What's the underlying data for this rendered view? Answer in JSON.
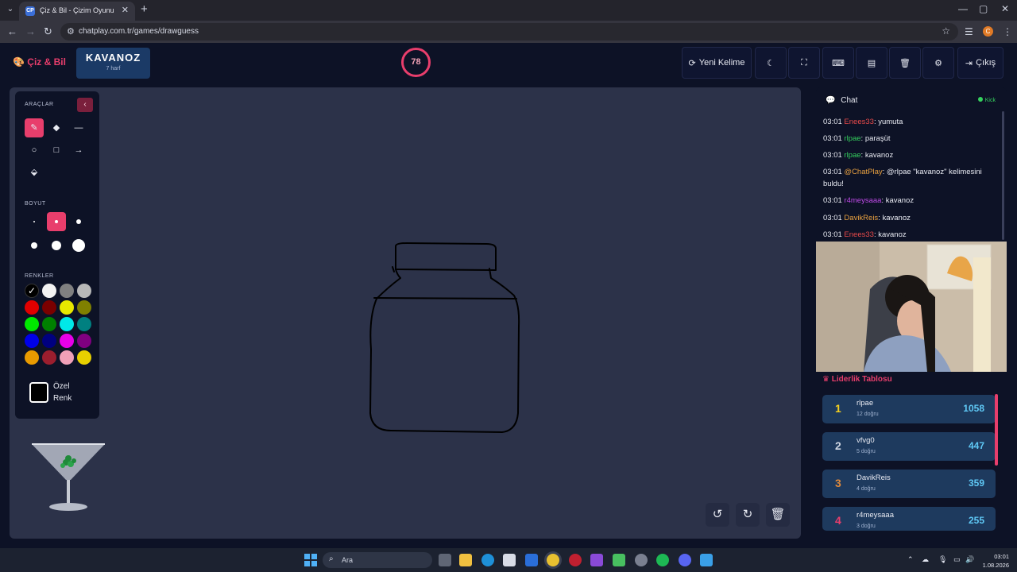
{
  "browser": {
    "tab_title": "Çiz & Bil - Çizim Oyunu",
    "favicon_text": "CP",
    "url": "chatplay.com.tr/games/drawguess",
    "profile_initial": "C"
  },
  "header": {
    "logo": "Çiz & Bil",
    "word": "KAVANOZ",
    "word_hint": "7 harf",
    "timer": "78",
    "buttons": {
      "new_word": "Yeni Kelime",
      "logout": "Çıkış"
    }
  },
  "tools": {
    "section_tools": "ARAÇLAR",
    "section_size": "BOYUT",
    "section_colors": "RENKLER",
    "custom_color_line1": "Özel",
    "custom_color_line2": "Renk",
    "colors": [
      "#000000",
      "#f2f2f2",
      "#808080",
      "#b8b8b8",
      "#e00000",
      "#7a0000",
      "#e8e800",
      "#808000",
      "#00e800",
      "#008000",
      "#00e8e8",
      "#008080",
      "#0000e8",
      "#000080",
      "#e800e8",
      "#800080",
      "#e89a00",
      "#9b1e2e",
      "#f0a0b8",
      "#e8d000"
    ]
  },
  "chat": {
    "title": "Chat",
    "platform": "Kick",
    "messages": [
      {
        "time": "03:01",
        "user": "Enees33",
        "color": "#e84a4a",
        "text": ": yumuta"
      },
      {
        "time": "03:01",
        "user": "rlpae",
        "color": "#35d15e",
        "text": ": paraşüt"
      },
      {
        "time": "03:01",
        "user": "rlpae",
        "color": "#35d15e",
        "text": ": kavanoz"
      },
      {
        "time": "03:01",
        "user": "@ChatPlay",
        "color": "#e8a040",
        "text": ": @rlpae \"kavanoz\" kelimesini buldu!"
      },
      {
        "time": "03:01",
        "user": "r4meysaaa",
        "color": "#c04ae8",
        "text": ": kavanoz"
      },
      {
        "time": "03:01",
        "user": "DavikReis",
        "color": "#e8a040",
        "text": ": kavanoz"
      },
      {
        "time": "03:01",
        "user": "Enees33",
        "color": "#e84a4a",
        "text": ": kavanoz"
      }
    ]
  },
  "leaderboard": {
    "title": "Liderlik Tablosu",
    "rows": [
      {
        "rank": "1",
        "name": "rlpae",
        "sub": "12 doğru",
        "score": "1058",
        "rank_color": "#f5d020"
      },
      {
        "rank": "2",
        "name": "vfvg0",
        "sub": "5 doğru",
        "score": "447",
        "rank_color": "#d0d6e2"
      },
      {
        "rank": "3",
        "name": "DavikReis",
        "sub": "4 doğru",
        "score": "359",
        "rank_color": "#e08a3c"
      },
      {
        "rank": "4",
        "name": "r4meysaaa",
        "sub": "3 doğru",
        "score": "255",
        "rank_color": "#e83e6c"
      }
    ]
  },
  "taskbar": {
    "search_label": "Ara",
    "time": "03:01",
    "date": "1.08.2026"
  }
}
